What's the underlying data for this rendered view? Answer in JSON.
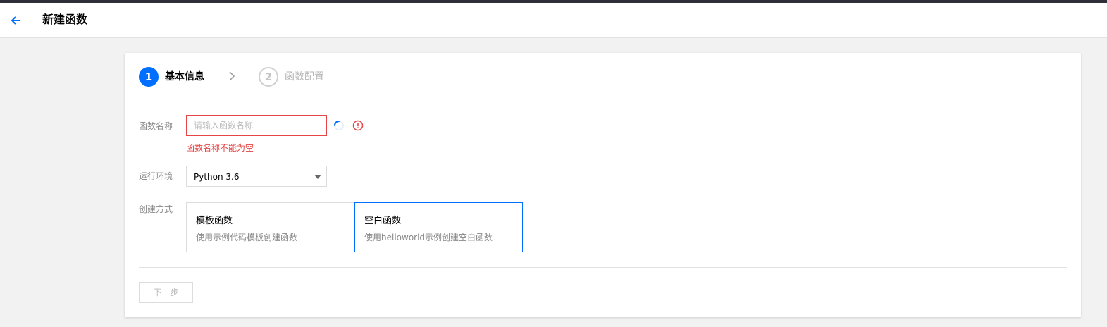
{
  "header": {
    "back_icon": "arrow-left-icon",
    "title": "新建函数"
  },
  "steps": [
    {
      "number": "1",
      "label": "基本信息",
      "active": true
    },
    {
      "number": "2",
      "label": "函数配置",
      "active": false
    }
  ],
  "form": {
    "name": {
      "label": "函数名称",
      "placeholder": "请输入函数名称",
      "value": "",
      "error": "函数名称不能为空"
    },
    "runtime": {
      "label": "运行环境",
      "value": "Python 3.6"
    },
    "create_method": {
      "label": "创建方式",
      "options": [
        {
          "title": "模板函数",
          "desc": "使用示例代码模板创建函数",
          "selected": false
        },
        {
          "title": "空白函数",
          "desc": "使用helloworld示例创建空白函数",
          "selected": true
        }
      ]
    }
  },
  "footer": {
    "next_label": "下一步"
  },
  "colors": {
    "accent": "#006eff",
    "error": "#e54545",
    "topbar": "#2d3038"
  }
}
